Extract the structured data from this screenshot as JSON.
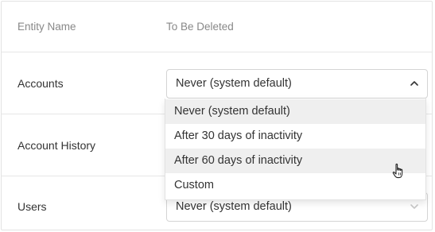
{
  "table": {
    "headers": {
      "entity_name": "Entity Name",
      "to_be_deleted": "To Be Deleted"
    },
    "rows": [
      {
        "label": "Accounts",
        "selected": "Never (system default)",
        "expanded": true
      },
      {
        "label": "Account History",
        "selected": ""
      },
      {
        "label": "Users",
        "selected": "Never (system default)",
        "expanded": false
      }
    ]
  },
  "dropdown": {
    "options": [
      "Never (system default)",
      "After 30 days of inactivity",
      "After 60 days of inactivity",
      "Custom"
    ],
    "selected_option": "Never (system default)",
    "hovered_option": "After 60 days of inactivity"
  },
  "icons": {
    "open_chevron": "chevron-up-icon",
    "closed_chevron": "chevron-down-icon",
    "cursor": "hand-pointer-icon"
  },
  "colors": {
    "highlight": "#efefef",
    "border": "#d4d4d4",
    "text": "#333333",
    "muted_text": "#888888"
  }
}
